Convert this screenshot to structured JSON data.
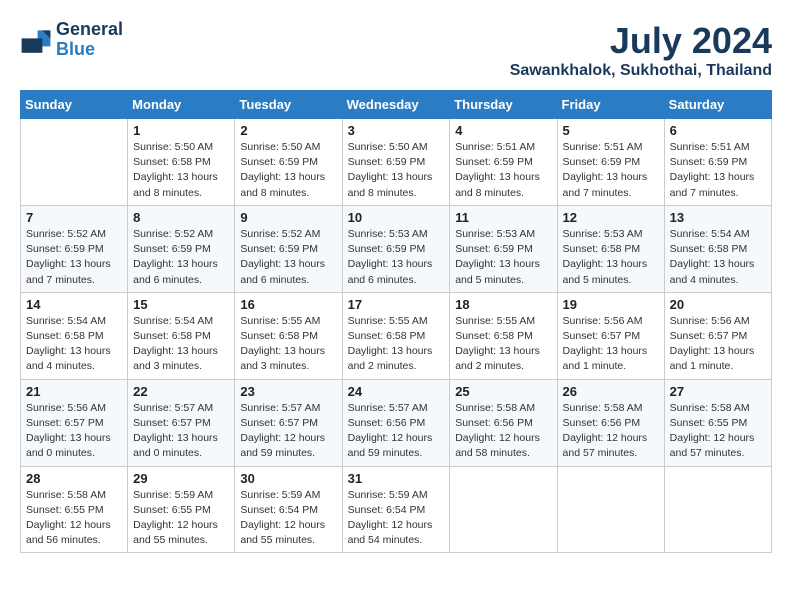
{
  "header": {
    "logo_line1": "General",
    "logo_line2": "Blue",
    "month": "July 2024",
    "location": "Sawankhalok, Sukhothai, Thailand"
  },
  "weekdays": [
    "Sunday",
    "Monday",
    "Tuesday",
    "Wednesday",
    "Thursday",
    "Friday",
    "Saturday"
  ],
  "weeks": [
    [
      {
        "day": "",
        "info": ""
      },
      {
        "day": "1",
        "info": "Sunrise: 5:50 AM\nSunset: 6:58 PM\nDaylight: 13 hours\nand 8 minutes."
      },
      {
        "day": "2",
        "info": "Sunrise: 5:50 AM\nSunset: 6:59 PM\nDaylight: 13 hours\nand 8 minutes."
      },
      {
        "day": "3",
        "info": "Sunrise: 5:50 AM\nSunset: 6:59 PM\nDaylight: 13 hours\nand 8 minutes."
      },
      {
        "day": "4",
        "info": "Sunrise: 5:51 AM\nSunset: 6:59 PM\nDaylight: 13 hours\nand 8 minutes."
      },
      {
        "day": "5",
        "info": "Sunrise: 5:51 AM\nSunset: 6:59 PM\nDaylight: 13 hours\nand 7 minutes."
      },
      {
        "day": "6",
        "info": "Sunrise: 5:51 AM\nSunset: 6:59 PM\nDaylight: 13 hours\nand 7 minutes."
      }
    ],
    [
      {
        "day": "7",
        "info": "Sunrise: 5:52 AM\nSunset: 6:59 PM\nDaylight: 13 hours\nand 7 minutes."
      },
      {
        "day": "8",
        "info": "Sunrise: 5:52 AM\nSunset: 6:59 PM\nDaylight: 13 hours\nand 6 minutes."
      },
      {
        "day": "9",
        "info": "Sunrise: 5:52 AM\nSunset: 6:59 PM\nDaylight: 13 hours\nand 6 minutes."
      },
      {
        "day": "10",
        "info": "Sunrise: 5:53 AM\nSunset: 6:59 PM\nDaylight: 13 hours\nand 6 minutes."
      },
      {
        "day": "11",
        "info": "Sunrise: 5:53 AM\nSunset: 6:59 PM\nDaylight: 13 hours\nand 5 minutes."
      },
      {
        "day": "12",
        "info": "Sunrise: 5:53 AM\nSunset: 6:58 PM\nDaylight: 13 hours\nand 5 minutes."
      },
      {
        "day": "13",
        "info": "Sunrise: 5:54 AM\nSunset: 6:58 PM\nDaylight: 13 hours\nand 4 minutes."
      }
    ],
    [
      {
        "day": "14",
        "info": "Sunrise: 5:54 AM\nSunset: 6:58 PM\nDaylight: 13 hours\nand 4 minutes."
      },
      {
        "day": "15",
        "info": "Sunrise: 5:54 AM\nSunset: 6:58 PM\nDaylight: 13 hours\nand 3 minutes."
      },
      {
        "day": "16",
        "info": "Sunrise: 5:55 AM\nSunset: 6:58 PM\nDaylight: 13 hours\nand 3 minutes."
      },
      {
        "day": "17",
        "info": "Sunrise: 5:55 AM\nSunset: 6:58 PM\nDaylight: 13 hours\nand 2 minutes."
      },
      {
        "day": "18",
        "info": "Sunrise: 5:55 AM\nSunset: 6:58 PM\nDaylight: 13 hours\nand 2 minutes."
      },
      {
        "day": "19",
        "info": "Sunrise: 5:56 AM\nSunset: 6:57 PM\nDaylight: 13 hours\nand 1 minute."
      },
      {
        "day": "20",
        "info": "Sunrise: 5:56 AM\nSunset: 6:57 PM\nDaylight: 13 hours\nand 1 minute."
      }
    ],
    [
      {
        "day": "21",
        "info": "Sunrise: 5:56 AM\nSunset: 6:57 PM\nDaylight: 13 hours\nand 0 minutes."
      },
      {
        "day": "22",
        "info": "Sunrise: 5:57 AM\nSunset: 6:57 PM\nDaylight: 13 hours\nand 0 minutes."
      },
      {
        "day": "23",
        "info": "Sunrise: 5:57 AM\nSunset: 6:57 PM\nDaylight: 12 hours\nand 59 minutes."
      },
      {
        "day": "24",
        "info": "Sunrise: 5:57 AM\nSunset: 6:56 PM\nDaylight: 12 hours\nand 59 minutes."
      },
      {
        "day": "25",
        "info": "Sunrise: 5:58 AM\nSunset: 6:56 PM\nDaylight: 12 hours\nand 58 minutes."
      },
      {
        "day": "26",
        "info": "Sunrise: 5:58 AM\nSunset: 6:56 PM\nDaylight: 12 hours\nand 57 minutes."
      },
      {
        "day": "27",
        "info": "Sunrise: 5:58 AM\nSunset: 6:55 PM\nDaylight: 12 hours\nand 57 minutes."
      }
    ],
    [
      {
        "day": "28",
        "info": "Sunrise: 5:58 AM\nSunset: 6:55 PM\nDaylight: 12 hours\nand 56 minutes."
      },
      {
        "day": "29",
        "info": "Sunrise: 5:59 AM\nSunset: 6:55 PM\nDaylight: 12 hours\nand 55 minutes."
      },
      {
        "day": "30",
        "info": "Sunrise: 5:59 AM\nSunset: 6:54 PM\nDaylight: 12 hours\nand 55 minutes."
      },
      {
        "day": "31",
        "info": "Sunrise: 5:59 AM\nSunset: 6:54 PM\nDaylight: 12 hours\nand 54 minutes."
      },
      {
        "day": "",
        "info": ""
      },
      {
        "day": "",
        "info": ""
      },
      {
        "day": "",
        "info": ""
      }
    ]
  ]
}
